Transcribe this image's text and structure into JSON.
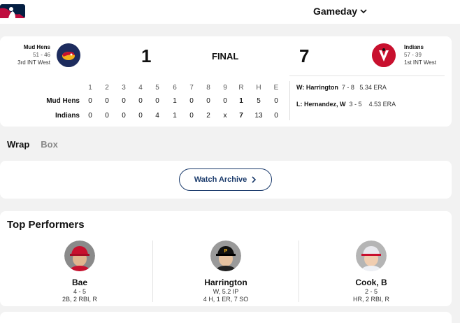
{
  "header": {
    "gameday_label": "Gameday"
  },
  "game": {
    "away": {
      "name": "Mud Hens",
      "record": "51 - 46",
      "standing": "3rd INT West",
      "score": "1",
      "line_label": "Mud Hens"
    },
    "home": {
      "name": "Indians",
      "record": "57 - 39",
      "standing": "1st INT West",
      "score": "7",
      "line_label": "Indians"
    },
    "status": "FINAL"
  },
  "linescore": {
    "headers": [
      "1",
      "2",
      "3",
      "4",
      "5",
      "6",
      "7",
      "8",
      "9",
      "R",
      "H",
      "E"
    ],
    "away": [
      "0",
      "0",
      "0",
      "0",
      "0",
      "1",
      "0",
      "0",
      "0",
      "1",
      "5",
      "0"
    ],
    "home": [
      "0",
      "0",
      "0",
      "0",
      "4",
      "1",
      "0",
      "2",
      "x",
      "7",
      "13",
      "0"
    ]
  },
  "decisions": {
    "win": {
      "prefix": "W:",
      "name": "Harrington",
      "record": "7 - 8",
      "era": "5.34 ERA"
    },
    "loss": {
      "prefix": "L:",
      "name": "Hernandez, W",
      "record": "3 - 5",
      "era": "4.53 ERA"
    }
  },
  "tabs": {
    "wrap": "Wrap",
    "box": "Box"
  },
  "archive": {
    "label": "Watch Archive"
  },
  "performers": {
    "title": "Top Performers",
    "players": [
      {
        "name": "Bae",
        "line1": "4 - 5",
        "line2": "2B, 2 RBI, R"
      },
      {
        "name": "Harrington",
        "line1": "W, 5.2 IP",
        "line2": "4 H, 1 ER, 7 SO"
      },
      {
        "name": "Cook, B",
        "line1": "2 - 5",
        "line2": "HR, 2 RBI, R"
      }
    ]
  },
  "colors": {
    "navy": "#1a3a6b",
    "mudhens": "#1d2c5e",
    "indians": "#c8102e",
    "mlb_blue": "#041e42",
    "mlb_red": "#bf0d3e"
  }
}
